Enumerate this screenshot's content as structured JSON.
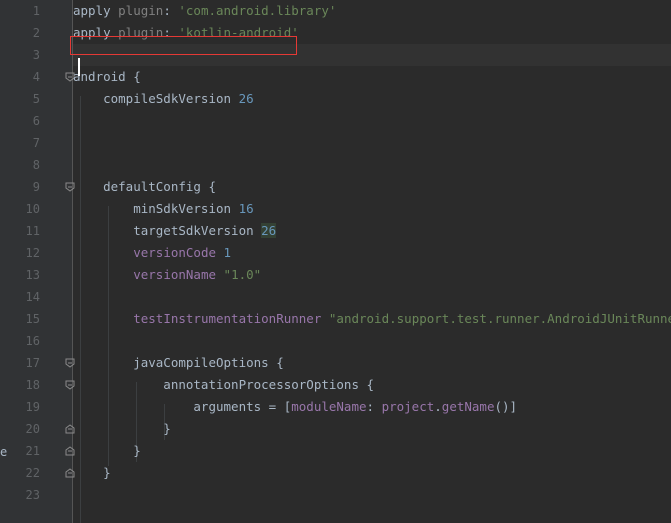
{
  "editor": {
    "stray_char": "e",
    "line_numbers": [
      "1",
      "2",
      "3",
      "4",
      "5",
      "6",
      "7",
      "8",
      "9",
      "10",
      "11",
      "12",
      "13",
      "14",
      "15",
      "16",
      "17",
      "18",
      "19",
      "20",
      "21",
      "22",
      "23"
    ],
    "lines": [
      {
        "tokens": [
          {
            "t": "plain",
            "v": "apply "
          },
          {
            "t": "gray",
            "v": "plugin"
          },
          {
            "t": "plain",
            "v": ": "
          },
          {
            "t": "str",
            "v": "'com.android.library'"
          }
        ]
      },
      {
        "tokens": [
          {
            "t": "plain",
            "v": "apply "
          },
          {
            "t": "gray",
            "v": "plugin"
          },
          {
            "t": "plain",
            "v": ": "
          },
          {
            "t": "str",
            "v": "'kotlin-android'"
          }
        ]
      },
      {
        "tokens": []
      },
      {
        "tokens": [
          {
            "t": "plain",
            "v": "android {"
          }
        ]
      },
      {
        "tokens": [
          {
            "t": "plain",
            "v": "    compileSdkVersion "
          },
          {
            "t": "num",
            "v": "26"
          }
        ]
      },
      {
        "tokens": []
      },
      {
        "tokens": []
      },
      {
        "tokens": []
      },
      {
        "tokens": [
          {
            "t": "plain",
            "v": "    defaultConfig {"
          }
        ]
      },
      {
        "tokens": [
          {
            "t": "plain",
            "v": "        minSdkVersion "
          },
          {
            "t": "num",
            "v": "16"
          }
        ]
      },
      {
        "tokens": [
          {
            "t": "plain",
            "v": "        targetSdkVersion "
          },
          {
            "t": "hl-num",
            "v": "26"
          }
        ]
      },
      {
        "tokens": [
          {
            "t": "plain",
            "v": "        "
          },
          {
            "t": "prop",
            "v": "versionCode"
          },
          {
            "t": "plain",
            "v": " "
          },
          {
            "t": "num",
            "v": "1"
          }
        ]
      },
      {
        "tokens": [
          {
            "t": "plain",
            "v": "        "
          },
          {
            "t": "prop",
            "v": "versionName"
          },
          {
            "t": "plain",
            "v": " "
          },
          {
            "t": "str",
            "v": "\"1.0\""
          }
        ]
      },
      {
        "tokens": []
      },
      {
        "tokens": [
          {
            "t": "plain",
            "v": "        "
          },
          {
            "t": "prop",
            "v": "testInstrumentationRunner"
          },
          {
            "t": "plain",
            "v": " "
          },
          {
            "t": "str",
            "v": "\"android.support.test.runner.AndroidJUnitRunner\""
          }
        ]
      },
      {
        "tokens": []
      },
      {
        "tokens": [
          {
            "t": "plain",
            "v": "        javaCompileOptions {"
          }
        ]
      },
      {
        "tokens": [
          {
            "t": "plain",
            "v": "            annotationProcessorOptions {"
          }
        ]
      },
      {
        "tokens": [
          {
            "t": "plain",
            "v": "                arguments = ["
          },
          {
            "t": "prop",
            "v": "moduleName"
          },
          {
            "t": "plain",
            "v": ": "
          },
          {
            "t": "prop",
            "v": "project"
          },
          {
            "t": "plain",
            "v": "."
          },
          {
            "t": "prop",
            "v": "getName"
          },
          {
            "t": "plain",
            "v": "()]"
          }
        ]
      },
      {
        "tokens": [
          {
            "t": "plain",
            "v": "            }"
          }
        ]
      },
      {
        "tokens": [
          {
            "t": "plain",
            "v": "        }"
          }
        ]
      },
      {
        "tokens": [
          {
            "t": "plain",
            "v": "    }"
          }
        ]
      },
      {
        "tokens": []
      }
    ],
    "current_line": 3,
    "highlighted_line": 2,
    "fold_markers": [
      {
        "line": 4,
        "kind": "start"
      },
      {
        "line": 9,
        "kind": "start"
      },
      {
        "line": 17,
        "kind": "start"
      },
      {
        "line": 18,
        "kind": "start"
      },
      {
        "line": 20,
        "kind": "end"
      },
      {
        "line": 21,
        "kind": "end"
      },
      {
        "line": 22,
        "kind": "end"
      }
    ],
    "colors": {
      "background": "#2b2b2b",
      "gutter": "#313335",
      "plain": "#a9b7c6",
      "string": "#6a8759",
      "number": "#6897bb",
      "property": "#9876aa",
      "highlight_border": "#e53935"
    }
  }
}
